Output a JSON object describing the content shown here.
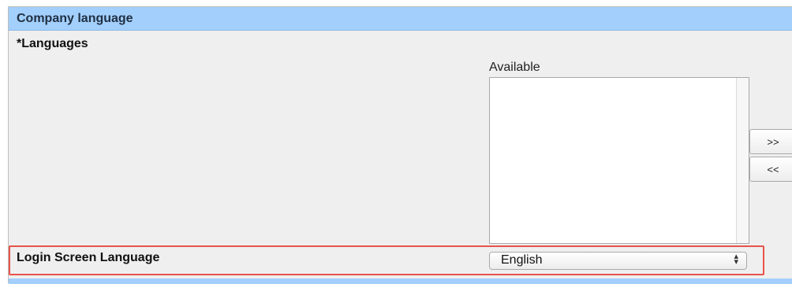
{
  "header": {
    "title": "Company language"
  },
  "languages": {
    "label": "*Languages",
    "available_label": "Available",
    "available_items": [],
    "add_button_label": ">>",
    "remove_button_label": "<<"
  },
  "login_screen": {
    "label": "Login Screen Language",
    "selected_value": "English",
    "highlight_color": "#e8534a"
  },
  "colors": {
    "header_bg": "#a3cffc",
    "panel_bg": "#efefef"
  }
}
